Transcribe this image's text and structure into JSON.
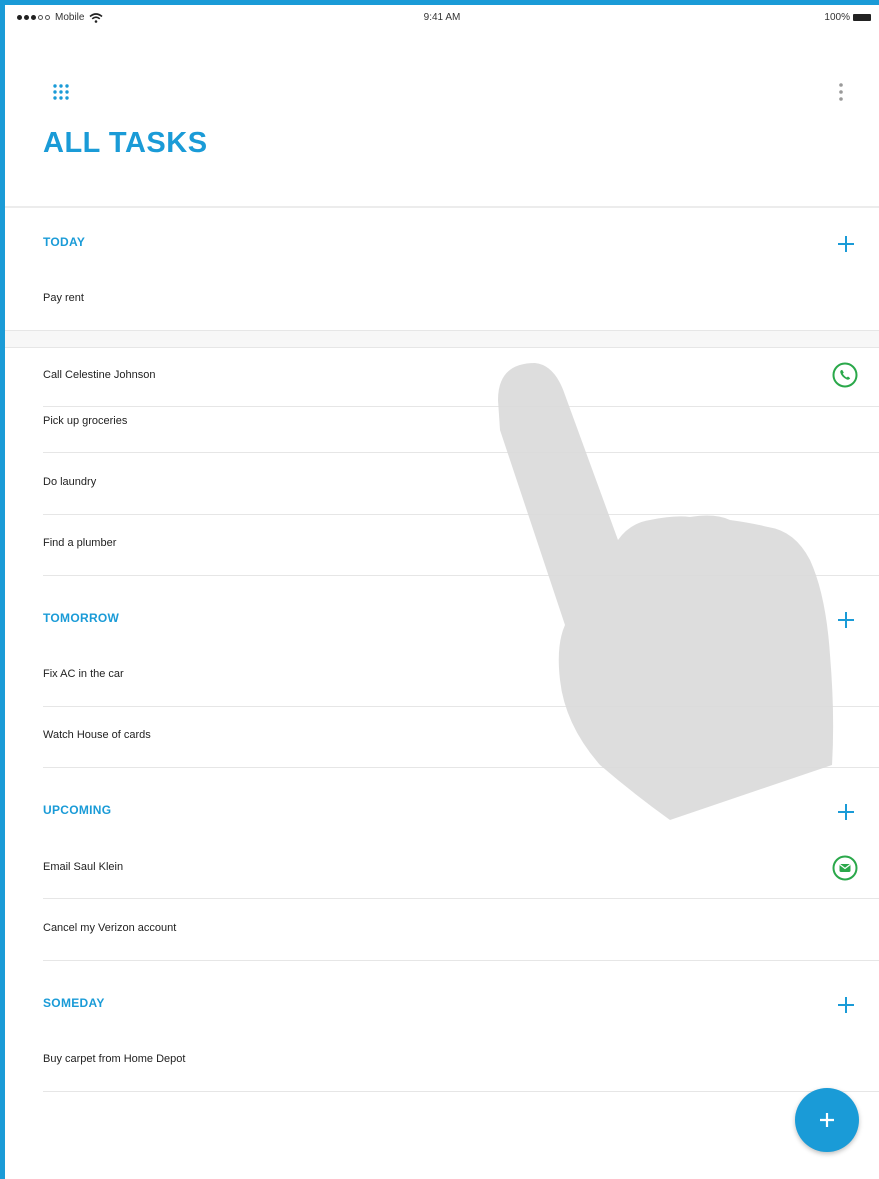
{
  "status_bar": {
    "carrier": "Mobile",
    "time": "9:41 AM",
    "battery": "100%"
  },
  "header": {
    "title": "ALL TASKS",
    "grid_icon": "apps-grid-icon",
    "menu_icon": "more-vertical-icon"
  },
  "sections": {
    "today": {
      "label": "TODAY",
      "items": [
        "Pay rent",
        "Call Celestine Johnson",
        "Pick up groceries",
        "Do laundry",
        "Find a plumber"
      ]
    },
    "tomorrow": {
      "label": "TOMORROW",
      "items": [
        "Fix AC in the car",
        "Watch House of cards"
      ]
    },
    "upcoming": {
      "label": "UPCOMING",
      "items": [
        "Email Saul Klein",
        "Cancel my Verizon account"
      ]
    },
    "someday": {
      "label": "SOMEDAY",
      "items": [
        "Buy carpet from Home Depot"
      ]
    }
  },
  "icons": {
    "call": "phone-icon",
    "email": "email-icon",
    "add": "plus-icon",
    "fab": "plus-icon"
  },
  "colors": {
    "accent": "#1a9bd7",
    "action_green": "#2aa84a",
    "overlay_hand": "#d9d9d9"
  }
}
